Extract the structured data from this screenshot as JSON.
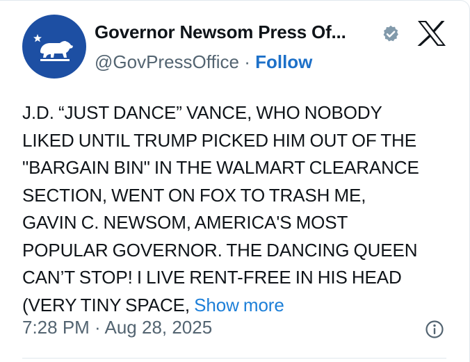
{
  "post": {
    "author_name": "Governor Newsom Press Of...",
    "handle": "@GovPressOffice",
    "separator": " · ",
    "follow_label": "Follow",
    "text_lines": [
      "J.D. “JUST DANCE” VANCE, WHO NOBODY",
      "LIKED UNTIL TRUMP PICKED HIM OUT OF THE",
      "\"BARGAIN BIN\" IN THE WALMART CLEARANCE",
      "SECTION, WENT ON FOX TO TRASH ME,",
      "GAVIN C. NEWSOM, AMERICA'S MOST",
      "POPULAR GOVERNOR. THE DANCING QUEEN",
      "CAN’T STOP! I LIVE RENT-FREE IN HIS HEAD",
      "(VERY TINY SPACE, "
    ],
    "show_more_label": "Show more",
    "timestamp": "7:28 PM · Aug 28, 2025"
  },
  "icons": {
    "avatar": "california-bear-flag-icon",
    "verified": "verified-badge-icon",
    "platform": "x-logo-icon",
    "info": "info-icon"
  },
  "colors": {
    "avatar_bg": "#1d4fa3",
    "link": "#1d70c8",
    "secondary_text": "#536471",
    "primary_text": "#0f1419",
    "verified_badge": "#829aab"
  }
}
